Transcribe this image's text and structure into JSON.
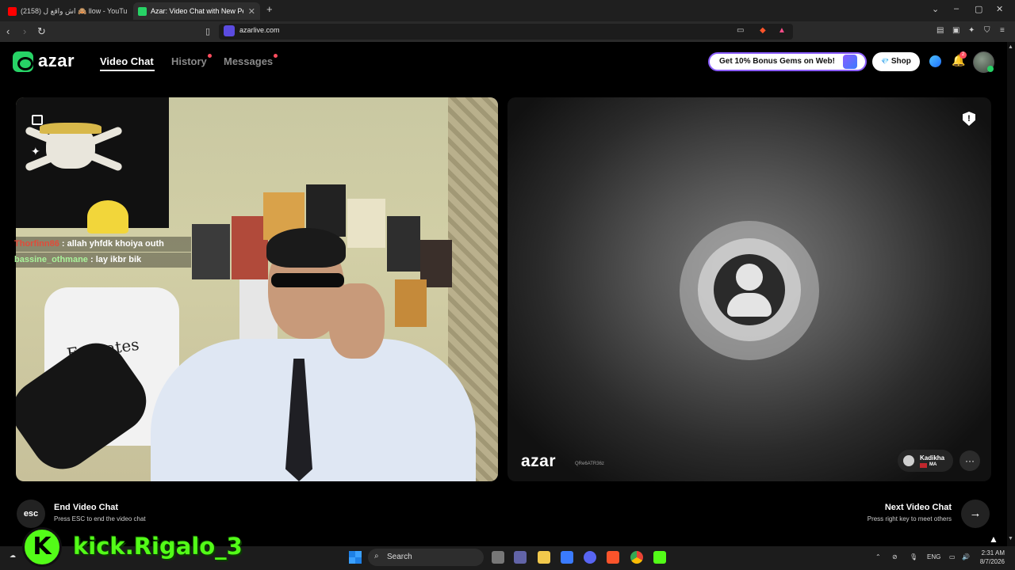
{
  "browser": {
    "tabs": [
      {
        "title": "(2158) اش واقع ل 🙈 llow - YouTube",
        "active": false
      },
      {
        "title": "Azar: Video Chat with New Pe",
        "active": true
      }
    ],
    "new_tab": "+",
    "url": "azarlive.com",
    "window_controls": [
      "⌄",
      "–",
      "▢",
      "✕"
    ]
  },
  "header": {
    "logo": "azar",
    "nav": [
      {
        "label": "Video Chat",
        "active": true,
        "dot": false
      },
      {
        "label": "History",
        "active": false,
        "dot": true
      },
      {
        "label": "Messages",
        "active": false,
        "dot": true
      }
    ],
    "bonus_label": "Get 10% Bonus Gems on Web!",
    "shop_label": "Shop",
    "shop_icon": "💎",
    "notification_count": "2"
  },
  "left_video": {
    "chat": [
      {
        "user": "Thorfinn86",
        "message": ": allah yhfdk khoiya outh",
        "user_color": "#e14b3a"
      },
      {
        "user": "bassine_othmane",
        "message": ": lay ikbr bik",
        "user_color": "#a9f29a"
      }
    ],
    "jersey_text": "Emirates"
  },
  "right_video": {
    "watermark": "azar",
    "watermark_id": "QRe6ATR36z",
    "partner_name": "Kadikha",
    "partner_country": "MA",
    "report_icon": "!"
  },
  "controls": {
    "esc_label": "esc",
    "end_title": "End Video Chat",
    "end_subtitle": "Press ESC to end the video chat",
    "next_title": "Next Video Chat",
    "next_subtitle": "Press right key to meet others",
    "next_icon": "→"
  },
  "overlay": {
    "kick_letter": "K",
    "kick_handle": "kick.Rigalo_3"
  },
  "taskbar": {
    "search_label": "Search",
    "language": "ENG",
    "time": "2:31 AM",
    "date": "8/7/2026"
  }
}
